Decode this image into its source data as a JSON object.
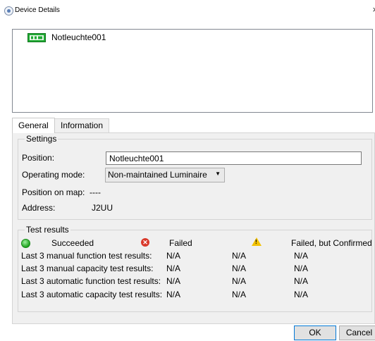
{
  "window": {
    "title": "Device Details",
    "close_glyph": "×"
  },
  "device": {
    "name": "Notleuchte001",
    "icon": "emergency-exit-light-icon",
    "icon_color": "#1faa33"
  },
  "tabs": [
    {
      "label": "General",
      "active": true
    },
    {
      "label": "Information",
      "active": false
    }
  ],
  "settings": {
    "group_title": "Settings",
    "position_label": "Position:",
    "position_value": "Notleuchte001",
    "operating_mode_label": "Operating mode:",
    "operating_mode_value": "Non-maintained Luminaire",
    "position_on_map_label": "Position on map:",
    "position_on_map_value": "----",
    "address_label": "Address:",
    "address_value": "J2UU"
  },
  "test_results": {
    "group_title": "Test results",
    "legend": [
      {
        "label": "Succeeded",
        "icon": "green-circle-icon",
        "color": "#1fa21f"
      },
      {
        "label": "Failed",
        "icon": "red-x-circle-icon",
        "color": "#d9392b"
      },
      {
        "label": "Failed, but Confirmed",
        "icon": "yellow-warning-icon",
        "color": "#f2c100"
      }
    ],
    "rows": [
      {
        "label": "Last 3 manual function test results:",
        "values": [
          "N/A",
          "N/A",
          "N/A"
        ]
      },
      {
        "label": "Last 3 manual capacity test results:",
        "values": [
          "N/A",
          "N/A",
          "N/A"
        ]
      },
      {
        "label": "Last 3 automatic function test results:",
        "values": [
          "N/A",
          "N/A",
          "N/A"
        ]
      },
      {
        "label": "Last 3 automatic capacity test results:",
        "values": [
          "N/A",
          "N/A",
          "N/A"
        ]
      }
    ]
  },
  "buttons": {
    "ok": "OK",
    "cancel": "Cancel"
  },
  "colors": {
    "accent": "#0078d7",
    "panel_bg": "#f0f0f0"
  }
}
